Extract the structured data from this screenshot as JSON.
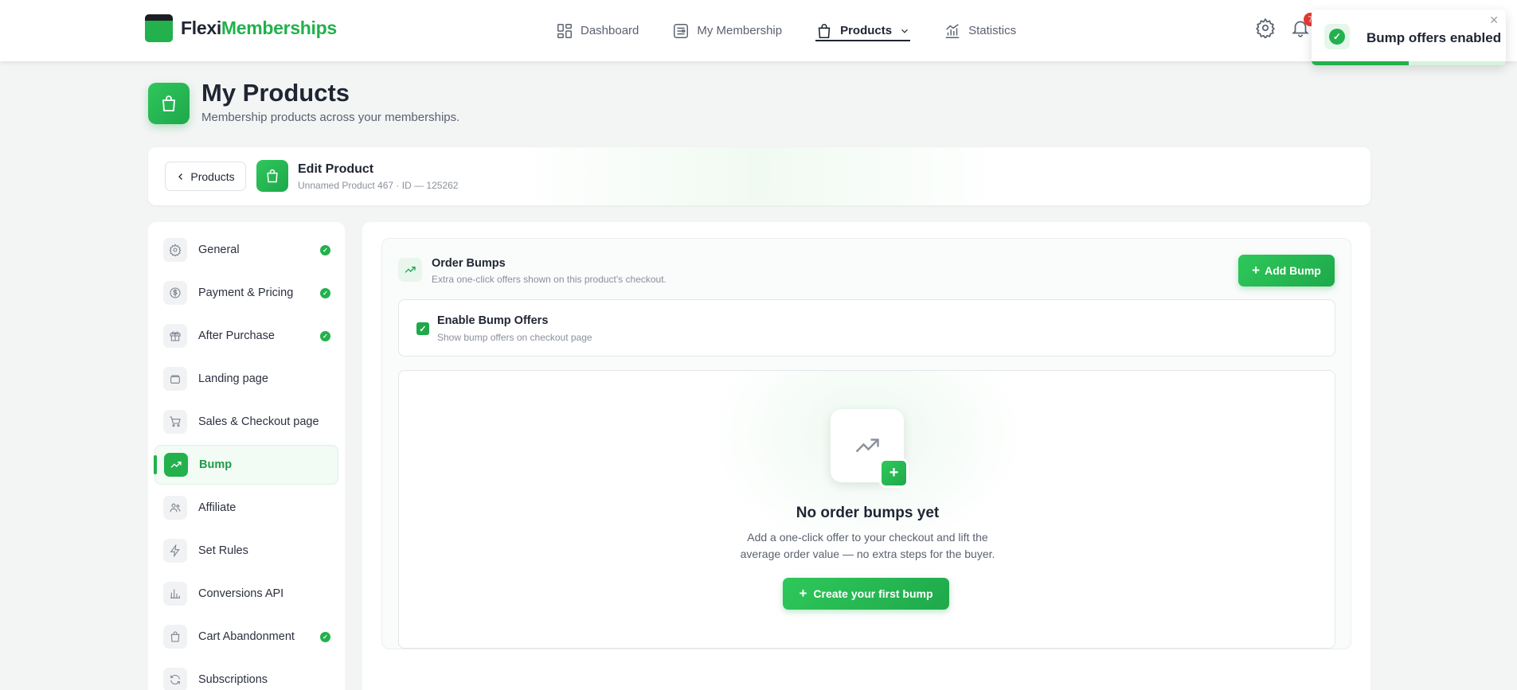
{
  "brand": {
    "name_a": "Flexi",
    "name_b": "Memberships"
  },
  "nav": {
    "items": [
      {
        "label": "Dashboard",
        "icon": "grid-icon"
      },
      {
        "label": "My Membership",
        "icon": "newspaper-icon"
      },
      {
        "label": "Products",
        "icon": "shopping-bag-icon",
        "active": true
      },
      {
        "label": "Statistics",
        "icon": "bar-chart-icon"
      }
    ],
    "notification_count": "7"
  },
  "toast": {
    "message": "Bump offers enabled",
    "close": "✕",
    "progress": 0.5
  },
  "page": {
    "title": "My Products",
    "subtitle": "Membership products across your memberships."
  },
  "edit_bar": {
    "back_label": "Products",
    "title": "Edit Product",
    "subtitle": "Unnamed Product 467 · ID — 125262"
  },
  "sidebar": {
    "items": [
      {
        "label": "General",
        "icon": "gear-icon",
        "done": true
      },
      {
        "label": "Payment & Pricing",
        "icon": "dollar-icon",
        "done": true
      },
      {
        "label": "After Purchase",
        "icon": "gift-icon",
        "done": true
      },
      {
        "label": "Landing page",
        "icon": "layout-icon",
        "done": false
      },
      {
        "label": "Sales & Checkout page",
        "icon": "cart-icon",
        "done": false
      },
      {
        "label": "Bump",
        "icon": "trending-up-icon",
        "done": false,
        "active": true
      },
      {
        "label": "Affiliate",
        "icon": "users-icon",
        "done": false
      },
      {
        "label": "Set Rules",
        "icon": "bolt-icon",
        "done": false
      },
      {
        "label": "Conversions API",
        "icon": "bar-chart-icon",
        "done": false
      },
      {
        "label": "Cart Abandonment",
        "icon": "shopping-bag-icon",
        "done": true
      },
      {
        "label": "Subscriptions",
        "icon": "refresh-icon",
        "done": false
      }
    ]
  },
  "order_bumps": {
    "title": "Order Bumps",
    "subtitle": "Extra one-click offers shown on this product's checkout.",
    "add_label": "Add Bump",
    "enable": {
      "title": "Enable Bump Offers",
      "subtitle": "Show bump offers on checkout page",
      "checked": true
    },
    "empty": {
      "title": "No order bumps yet",
      "desc_line1": "Add a one-click offer to your checkout and lift the",
      "desc_line2": "average order value — no extra steps for the buyer.",
      "cta": "Create your first bump"
    }
  },
  "colors": {
    "accent": "#22b14c",
    "text": "#1f2533",
    "muted": "#5a6170",
    "badge": "#e53935"
  }
}
